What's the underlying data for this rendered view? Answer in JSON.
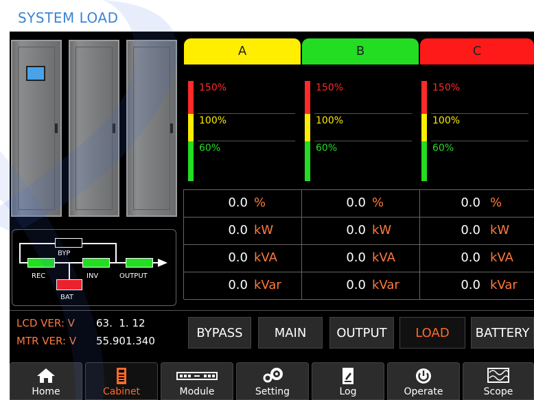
{
  "title": "SYSTEM LOAD",
  "phases": [
    {
      "label": "A",
      "color": "#ffee00"
    },
    {
      "label": "B",
      "color": "#22dd22"
    },
    {
      "label": "C",
      "color": "#ff1a1a"
    }
  ],
  "bar_levels": [
    "150%",
    "100%",
    "60%"
  ],
  "level_colors": {
    "150": "#ff2a2a",
    "100": "#ffee00",
    "60": "#22dd22"
  },
  "measurements": [
    {
      "unit": "%",
      "values": [
        "0.0",
        "0.0",
        "0.0"
      ]
    },
    {
      "unit": "kW",
      "values": [
        "0.0",
        "0.0",
        "0.0"
      ]
    },
    {
      "unit": "kVA",
      "values": [
        "0.0",
        "0.0",
        "0.0"
      ]
    },
    {
      "unit": "kVar",
      "values": [
        "0.0",
        "0.0",
        "0.0"
      ]
    }
  ],
  "diagram": {
    "byp": "BYP",
    "rec": "REC",
    "inv": "INV",
    "output": "OUTPUT",
    "bat": "BAT"
  },
  "version": {
    "lcd_label": "LCD VER: V",
    "lcd_value": "63.  1. 12",
    "mtr_label": "MTR VER: V",
    "mtr_value": "55.901.340"
  },
  "tabs": [
    {
      "label": "BYPASS",
      "selected": false
    },
    {
      "label": "MAIN",
      "selected": false
    },
    {
      "label": "OUTPUT",
      "selected": false
    },
    {
      "label": "LOAD",
      "selected": true
    },
    {
      "label": "BATTERY",
      "selected": false
    }
  ],
  "nav": [
    {
      "label": "Home",
      "icon": "home-icon",
      "selected": false
    },
    {
      "label": "Cabinet",
      "icon": "cabinet-icon",
      "selected": true
    },
    {
      "label": "Module",
      "icon": "module-icon",
      "selected": false
    },
    {
      "label": "Setting",
      "icon": "gear-icon",
      "selected": false
    },
    {
      "label": "Log",
      "icon": "log-icon",
      "selected": false
    },
    {
      "label": "Operate",
      "icon": "power-icon",
      "selected": false
    },
    {
      "label": "Scope",
      "icon": "scope-icon",
      "selected": false
    }
  ],
  "colors": {
    "accent": "#ff6a2a",
    "title": "#3b84d4",
    "unit": "#ff7a3c",
    "version": "#ff7a3c"
  }
}
